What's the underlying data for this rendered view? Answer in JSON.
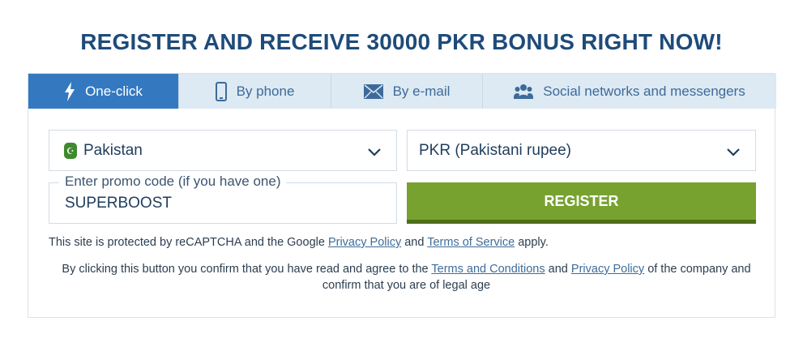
{
  "title": "REGISTER AND RECEIVE 30000 PKR BONUS RIGHT NOW!",
  "tabs": [
    {
      "label": "One-click",
      "icon": "lightning-icon",
      "active": true
    },
    {
      "label": "By phone",
      "icon": "phone-icon",
      "active": false
    },
    {
      "label": "By e-mail",
      "icon": "envelope-icon",
      "active": false
    },
    {
      "label": "Social networks and messengers",
      "icon": "users-icon",
      "active": false
    }
  ],
  "form": {
    "country": "Pakistan",
    "currency": "PKR (Pakistani rupee)",
    "promo_label": "Enter promo code (if you have one)",
    "promo_value": "SUPERBOOST",
    "register_label": "REGISTER"
  },
  "recaptcha": {
    "prefix": "This site is protected by reCAPTCHA and the Google",
    "privacy_link": "Privacy Policy",
    "and": "and",
    "terms_link": "Terms of Service",
    "suffix": "apply."
  },
  "consent": {
    "prefix": "By clicking this button you confirm that you have read and agree to the",
    "terms_link": "Terms and Conditions",
    "and": "and",
    "privacy_link": "Privacy Policy",
    "suffix": "of the company and confirm that you are of legal age"
  },
  "colors": {
    "title": "#1e4b7a",
    "tab_active": "#3479c0",
    "tab_inactive": "#dde9f3",
    "register": "#77a22f"
  }
}
